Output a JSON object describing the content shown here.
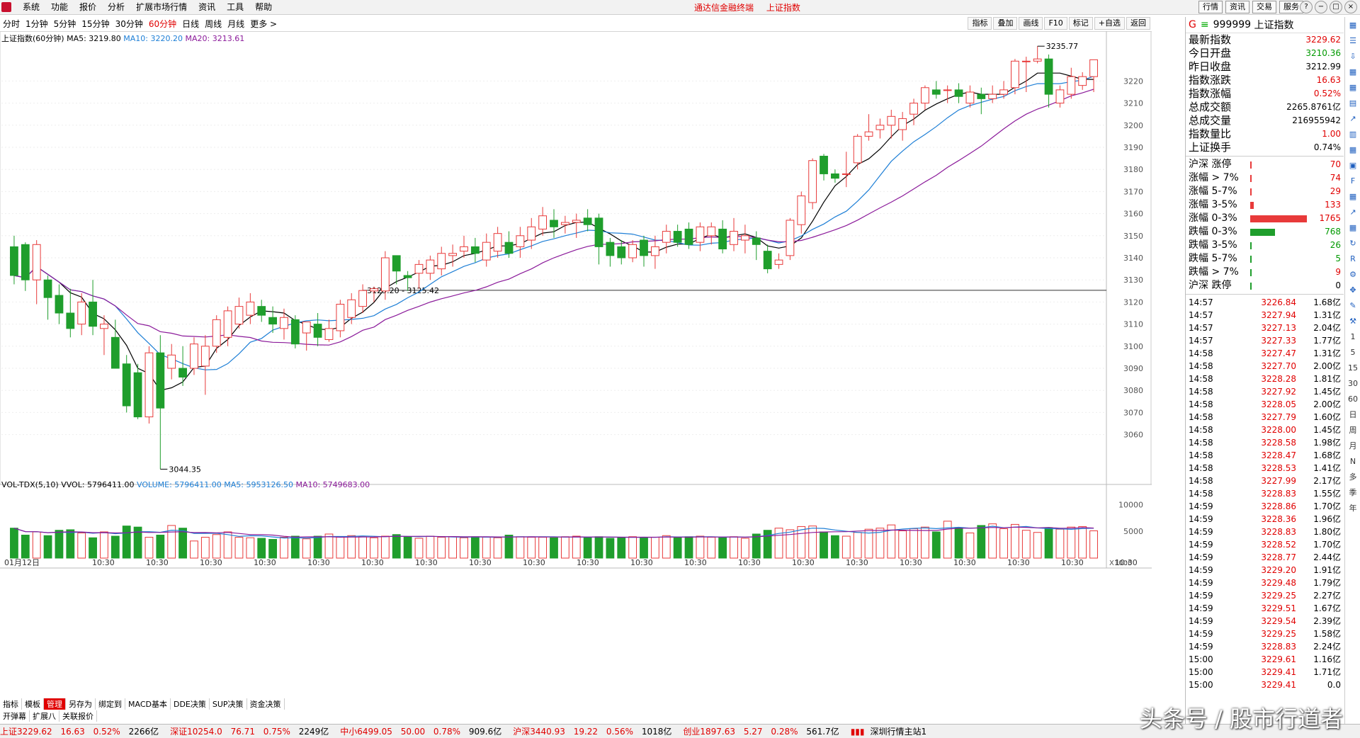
{
  "menu": [
    "系统",
    "功能",
    "报价",
    "分析",
    "扩展市场行情",
    "资讯",
    "工具",
    "帮助"
  ],
  "title": {
    "app": "通达信金融终端",
    "index": "上证指数"
  },
  "top_right_tabs": [
    "行情",
    "资讯",
    "交易",
    "服务"
  ],
  "periods": [
    {
      "label": "分时",
      "active": false
    },
    {
      "label": "1分钟",
      "active": false
    },
    {
      "label": "5分钟",
      "active": false
    },
    {
      "label": "15分钟",
      "active": false
    },
    {
      "label": "30分钟",
      "active": false
    },
    {
      "label": "60分钟",
      "active": true
    },
    {
      "label": "日线",
      "active": false
    },
    {
      "label": "周线",
      "active": false
    },
    {
      "label": "月线",
      "active": false
    },
    {
      "label": "更多 >",
      "active": false
    }
  ],
  "chart_tools": [
    "指标",
    "叠加",
    "画线",
    "F10",
    "标记",
    "+自选",
    "返回"
  ],
  "chart_data": {
    "type": "candlestick",
    "title": "上证指数(60分钟)",
    "ma_legend": [
      {
        "name": "MA5",
        "value": "3219.80",
        "color": "#000000"
      },
      {
        "name": "MA10",
        "value": "3220.20",
        "color": "#1e7fd6"
      },
      {
        "name": "MA20",
        "value": "3213.61",
        "color": "#8b1a9a"
      }
    ],
    "ylim": [
      3040,
      3240
    ],
    "y_ticks": [
      3060,
      3070,
      3080,
      3090,
      3100,
      3110,
      3120,
      3130,
      3140,
      3150,
      3160,
      3170,
      3180,
      3190,
      3200,
      3210,
      3220
    ],
    "annotations": {
      "high": "3235.77",
      "low": "3044.35",
      "hline": "3125.20 - 3125.42",
      "hline_value": 3125.3
    },
    "x_labels": [
      "01月12日",
      "10:30",
      "10:30",
      "10:30",
      "10:30",
      "10:30",
      "10:30",
      "10:30",
      "10:30",
      "10:30",
      "10:30",
      "10:30",
      "10:30",
      "10:30",
      "10:30",
      "10:30",
      "10:30",
      "10:30",
      "10:30",
      "10:30",
      "10:30"
    ],
    "candles": [
      [
        3145,
        3150,
        3128,
        3132
      ],
      [
        3146,
        3147,
        3125,
        3130
      ],
      [
        3130,
        3148,
        3119,
        3146
      ],
      [
        3130,
        3132,
        3112,
        3122
      ],
      [
        3123,
        3128,
        3110,
        3115
      ],
      [
        3115,
        3126,
        3104,
        3108
      ],
      [
        3110,
        3124,
        3105,
        3120
      ],
      [
        3120,
        3130,
        3105,
        3109
      ],
      [
        3108,
        3114,
        3096,
        3110
      ],
      [
        3104,
        3112,
        3090,
        3090
      ],
      [
        3092,
        3096,
        3070,
        3073
      ],
      [
        3088,
        3092,
        3067,
        3068
      ],
      [
        3068,
        3100,
        3065,
        3097
      ],
      [
        3097,
        3105,
        3044.35,
        3072
      ],
      [
        3090,
        3101,
        3085,
        3096
      ],
      [
        3090,
        3100,
        3082,
        3086
      ],
      [
        3090,
        3104,
        3087,
        3101
      ],
      [
        3091,
        3105,
        3078,
        3100
      ],
      [
        3100,
        3114,
        3097,
        3112
      ],
      [
        3104,
        3118,
        3100,
        3116
      ],
      [
        3110,
        3122,
        3108,
        3118
      ],
      [
        3114,
        3124,
        3110,
        3120
      ],
      [
        3118,
        3121,
        3111,
        3114
      ],
      [
        3113,
        3118,
        3106,
        3110
      ],
      [
        3108,
        3117,
        3103,
        3113
      ],
      [
        3112,
        3114,
        3099,
        3101
      ],
      [
        3106,
        3111,
        3098,
        3111
      ],
      [
        3110,
        3115,
        3100,
        3104
      ],
      [
        3103,
        3112,
        3102,
        3108
      ],
      [
        3107,
        3121,
        3104,
        3119
      ],
      [
        3113,
        3124,
        3110,
        3121
      ],
      [
        3118,
        3128,
        3115,
        3125.2
      ],
      [
        3125,
        3127,
        3120,
        3126
      ],
      [
        3125,
        3143,
        3121,
        3140
      ],
      [
        3141,
        3141,
        3128,
        3134
      ],
      [
        3132,
        3134,
        3125,
        3131
      ],
      [
        3133,
        3139,
        3126,
        3137
      ],
      [
        3133,
        3141,
        3130,
        3139
      ],
      [
        3135,
        3145,
        3132,
        3142
      ],
      [
        3141,
        3146,
        3136,
        3142
      ],
      [
        3143,
        3150,
        3140,
        3145
      ],
      [
        3145,
        3149,
        3138,
        3142
      ],
      [
        3139,
        3151,
        3136,
        3147
      ],
      [
        3143,
        3154,
        3140,
        3151
      ],
      [
        3147,
        3152,
        3140,
        3142
      ],
      [
        3145,
        3154,
        3140,
        3150
      ],
      [
        3148,
        3158,
        3144,
        3154
      ],
      [
        3153,
        3163,
        3150,
        3159
      ],
      [
        3157,
        3162,
        3149,
        3154
      ],
      [
        3155,
        3159,
        3151,
        3156
      ],
      [
        3156,
        3160,
        3149,
        3157
      ],
      [
        3158,
        3162,
        3152,
        3155
      ],
      [
        3158,
        3160,
        3137,
        3145
      ],
      [
        3147,
        3149,
        3136,
        3141
      ],
      [
        3145,
        3148,
        3137,
        3140
      ],
      [
        3140,
        3148,
        3138,
        3146
      ],
      [
        3148,
        3150,
        3136,
        3141
      ],
      [
        3141,
        3150,
        3135,
        3145
      ],
      [
        3147,
        3155,
        3142,
        3152
      ],
      [
        3152,
        3155,
        3145,
        3147
      ],
      [
        3153,
        3156,
        3144,
        3146
      ],
      [
        3147,
        3156,
        3143,
        3154
      ],
      [
        3150,
        3156,
        3146,
        3154
      ],
      [
        3153,
        3157,
        3142,
        3144
      ],
      [
        3146,
        3158,
        3143,
        3152
      ],
      [
        3148,
        3155,
        3142,
        3150
      ],
      [
        3149,
        3152,
        3139,
        3146
      ],
      [
        3143,
        3146,
        3133,
        3135
      ],
      [
        3137,
        3142,
        3135,
        3139
      ],
      [
        3141,
        3158,
        3139,
        3157
      ],
      [
        3155,
        3170,
        3151,
        3168
      ],
      [
        3165,
        3185,
        3162,
        3184
      ],
      [
        3186,
        3187,
        3175,
        3178
      ],
      [
        3178,
        3180,
        3174,
        3176
      ],
      [
        3178,
        3188,
        3172,
        3178
      ],
      [
        3183,
        3196,
        3180,
        3195
      ],
      [
        3195,
        3205,
        3193,
        3197
      ],
      [
        3198,
        3203,
        3194,
        3200
      ],
      [
        3200,
        3207,
        3194,
        3204
      ],
      [
        3198,
        3206,
        3193,
        3203
      ],
      [
        3205,
        3212,
        3200,
        3210
      ],
      [
        3210,
        3218,
        3207,
        3217
      ],
      [
        3216,
        3220,
        3212,
        3214
      ],
      [
        3216,
        3218,
        3210,
        3216
      ],
      [
        3216,
        3219,
        3210,
        3213
      ],
      [
        3210,
        3218,
        3208,
        3215
      ],
      [
        3214,
        3217,
        3205,
        3212
      ],
      [
        3212,
        3218,
        3210,
        3214
      ],
      [
        3214,
        3220,
        3212,
        3216
      ],
      [
        3217,
        3230,
        3214,
        3229
      ],
      [
        3229,
        3231,
        3215,
        3229
      ],
      [
        3229,
        3235.77,
        3228,
        3230
      ],
      [
        3230,
        3232,
        3208,
        3214
      ],
      [
        3210,
        3218,
        3208,
        3216
      ],
      [
        3214,
        3226,
        3212,
        3222
      ],
      [
        3218,
        3224,
        3216,
        3222
      ],
      [
        3222,
        3229,
        3215,
        3229.62
      ]
    ],
    "volume": {
      "legend": [
        {
          "name": "VOL-TDX(5,10)",
          "value": "",
          "color": "#000000"
        },
        {
          "name": "VVOL",
          "value": "5796411.00",
          "color": "#000000"
        },
        {
          "name": "VOLUME",
          "value": "5796411.00",
          "color": "#1e7fd6"
        },
        {
          "name": "MA5",
          "value": "5953126.50",
          "color": "#1e7fd6"
        },
        {
          "name": "MA10",
          "value": "5749683.00",
          "color": "#8b1a9a"
        }
      ],
      "y_ticks": [
        5000,
        10000
      ],
      "unit_label": "X1000",
      "values": [
        5600,
        4300,
        4900,
        4200,
        5200,
        5300,
        4700,
        3800,
        4900,
        4100,
        6000,
        5800,
        3900,
        4300,
        6100,
        5600,
        3200,
        3900,
        4400,
        4900,
        3900,
        3800,
        3700,
        3500,
        3900,
        4100,
        3600,
        4100,
        4500,
        3900,
        4200,
        4000,
        3800,
        4100,
        4400,
        4000,
        3700,
        4100,
        3900,
        4000,
        3800,
        4000,
        3900,
        3800,
        4300,
        4000,
        3900,
        3900,
        3800,
        4000,
        4100,
        3800,
        4000,
        3700,
        3900,
        4000,
        3900,
        3900,
        4200,
        3800,
        4000,
        4100,
        3900,
        3800,
        4000,
        3700,
        4500,
        5200,
        5600,
        5300,
        5900,
        6000,
        4900,
        4200,
        4100,
        4800,
        5400,
        5600,
        6200,
        5100,
        5500,
        5800,
        4900,
        6900,
        5700,
        4700,
        6100,
        6400,
        5500,
        6300,
        5200,
        4800,
        5700,
        5400,
        5800,
        5900,
        5100
      ],
      "ylim": [
        0,
        13500
      ]
    }
  },
  "quote": {
    "code": "999999",
    "name": "上证指数",
    "rows": [
      {
        "label": "最新指数",
        "value": "3229.62",
        "color": "red"
      },
      {
        "label": "今日开盘",
        "value": "3210.36",
        "color": "green"
      },
      {
        "label": "昨日收盘",
        "value": "3212.99",
        "color": "black"
      },
      {
        "label": "指数涨跌",
        "value": "16.63",
        "color": "red"
      },
      {
        "label": "指数涨幅",
        "value": "0.52%",
        "color": "red"
      },
      {
        "label": "总成交额",
        "value": "2265.8761亿",
        "color": "black"
      },
      {
        "label": "总成交量",
        "value": "216955942",
        "color": "black"
      },
      {
        "label": "指数量比",
        "value": "1.00",
        "color": "red"
      },
      {
        "label": "上证换手",
        "value": "0.74%",
        "color": "black"
      }
    ],
    "dist": [
      {
        "label": "沪深 涨停",
        "count": "70",
        "frac": 0.03,
        "color": "#e83a3a",
        "ccolor": "red"
      },
      {
        "label": "涨幅 > 7%",
        "count": "74",
        "frac": 0.03,
        "color": "#e83a3a",
        "ccolor": "red"
      },
      {
        "label": "涨幅 5-7%",
        "count": "29",
        "frac": 0.015,
        "color": "#e83a3a",
        "ccolor": "red"
      },
      {
        "label": "涨幅 3-5%",
        "count": "133",
        "frac": 0.06,
        "color": "#e83a3a",
        "ccolor": "red"
      },
      {
        "label": "涨幅 0-3%",
        "count": "1765",
        "frac": 1.0,
        "color": "#e83a3a",
        "ccolor": "red"
      },
      {
        "label": "跌幅 0-3%",
        "count": "768",
        "frac": 0.44,
        "color": "#1f9e2c",
        "ccolor": "green"
      },
      {
        "label": "跌幅 3-5%",
        "count": "26",
        "frac": 0.01,
        "color": "#1f9e2c",
        "ccolor": "green"
      },
      {
        "label": "跌幅 5-7%",
        "count": "5",
        "frac": 0.005,
        "color": "#1f9e2c",
        "ccolor": "green"
      },
      {
        "label": "跌幅 > 7%",
        "count": "9",
        "frac": 0.005,
        "color": "#1f9e2c",
        "ccolor": "red"
      },
      {
        "label": "沪深 跌停",
        "count": "0",
        "frac": 0.003,
        "color": "#1f9e2c",
        "ccolor": "black"
      }
    ],
    "ticks": [
      [
        "14:57",
        "3226.84",
        "1.68亿"
      ],
      [
        "14:57",
        "3227.94",
        "1.31亿"
      ],
      [
        "14:57",
        "3227.13",
        "2.04亿"
      ],
      [
        "14:57",
        "3227.33",
        "1.77亿"
      ],
      [
        "14:58",
        "3227.47",
        "1.31亿"
      ],
      [
        "14:58",
        "3227.70",
        "2.00亿"
      ],
      [
        "14:58",
        "3228.28",
        "1.81亿"
      ],
      [
        "14:58",
        "3227.92",
        "1.45亿"
      ],
      [
        "14:58",
        "3228.05",
        "2.00亿"
      ],
      [
        "14:58",
        "3227.79",
        "1.60亿"
      ],
      [
        "14:58",
        "3228.00",
        "1.45亿"
      ],
      [
        "14:58",
        "3228.58",
        "1.98亿"
      ],
      [
        "14:58",
        "3228.47",
        "1.68亿"
      ],
      [
        "14:58",
        "3228.53",
        "1.41亿"
      ],
      [
        "14:58",
        "3227.99",
        "2.17亿"
      ],
      [
        "14:58",
        "3228.83",
        "1.55亿"
      ],
      [
        "14:59",
        "3228.86",
        "1.70亿"
      ],
      [
        "14:59",
        "3228.36",
        "1.96亿"
      ],
      [
        "14:59",
        "3228.83",
        "1.80亿"
      ],
      [
        "14:59",
        "3228.52",
        "1.70亿"
      ],
      [
        "14:59",
        "3228.77",
        "2.44亿"
      ],
      [
        "14:59",
        "3229.20",
        "1.91亿"
      ],
      [
        "14:59",
        "3229.48",
        "1.79亿"
      ],
      [
        "14:59",
        "3229.25",
        "2.27亿"
      ],
      [
        "14:59",
        "3229.51",
        "1.67亿"
      ],
      [
        "14:59",
        "3229.54",
        "2.39亿"
      ],
      [
        "14:59",
        "3229.25",
        "1.58亿"
      ],
      [
        "14:59",
        "3228.83",
        "2.24亿"
      ],
      [
        "15:00",
        "3229.61",
        "1.16亿"
      ],
      [
        "15:00",
        "3229.41",
        "1.71亿"
      ],
      [
        "15:00",
        "3229.41",
        "0.0"
      ]
    ]
  },
  "sidebar_icons": [
    "grid-icon",
    "list-icon",
    "download-icon",
    "grid-icon",
    "grid-icon",
    "calendar-icon",
    "chart-icon",
    "bar-icon",
    "grid-icon",
    "news-icon",
    "f10-icon",
    "grid-icon",
    "chart-icon",
    "grid-icon",
    "refresh-icon",
    "rsi-label",
    "settings-icon",
    "move-icon",
    "pen-icon",
    "tool-icon",
    "grid-icon",
    "grid-icon"
  ],
  "sidebar_labels": [
    "1",
    "5",
    "15",
    "30",
    "60",
    "日",
    "周",
    "月",
    "N",
    "多",
    "季",
    "年"
  ],
  "bottom_tabs": [
    "指标",
    "模板",
    "管理",
    "另存为",
    "绑定到",
    "MACD基本",
    "DDE决策",
    "SUP决策",
    "资金决策"
  ],
  "bottom_tabs2": [
    "开弹幕",
    "扩展八",
    "关联报价"
  ],
  "status": {
    "sh": "上证3229.62",
    "sh_chg": "16.63",
    "sh_pct": "0.52%",
    "sh_amt": "2266亿",
    "sz": "深证10254.0",
    "sz_chg": "76.71",
    "sz_pct": "0.75%",
    "sz_amt": "2249亿",
    "zx": "中小6499.05",
    "zx_chg": "50.00",
    "zx_pct": "0.78%",
    "zx_amt": "909.6亿",
    "hs": "沪深3440.93",
    "hs_chg": "19.22",
    "hs_pct": "0.56%",
    "hs_amt": "1018亿",
    "cy": "创业1897.63",
    "cy_chg": "5.27",
    "cy_pct": "0.28%",
    "cy_amt": "561.7亿",
    "server": "深圳行情主站1"
  },
  "watermark": "头条号 / 股市行道者"
}
